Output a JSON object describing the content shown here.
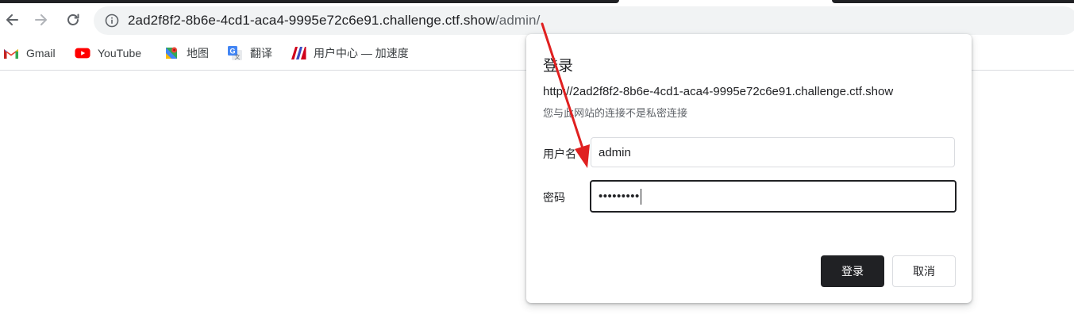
{
  "browser": {
    "url_host": "2ad2f8f2-8b6e-4cd1-aca4-9995e72c6e91.challenge.ctf.show",
    "url_path": "/admin/"
  },
  "bookmarks": [
    {
      "label": "Gmail",
      "icon": "gmail-icon"
    },
    {
      "label": "YouTube",
      "icon": "youtube-icon"
    },
    {
      "label": "地图",
      "icon": "maps-icon"
    },
    {
      "label": "翻译",
      "icon": "translate-icon"
    },
    {
      "label": "用户中心 — 加速度",
      "icon": "site-logo-icon"
    }
  ],
  "dialog": {
    "title": "登录",
    "origin": "http://2ad2f8f2-8b6e-4cd1-aca4-9995e72c6e91.challenge.ctf.show",
    "warning": "您与此网站的连接不是私密连接",
    "username_label": "用户名",
    "username_value": "admin",
    "password_label": "密码",
    "password_masked": "•••••••••",
    "login_button": "登录",
    "cancel_button": "取消"
  },
  "colors": {
    "annotation_arrow": "#e02020",
    "primary_button": "#202124",
    "omnibox_bg": "#f1f3f4"
  }
}
